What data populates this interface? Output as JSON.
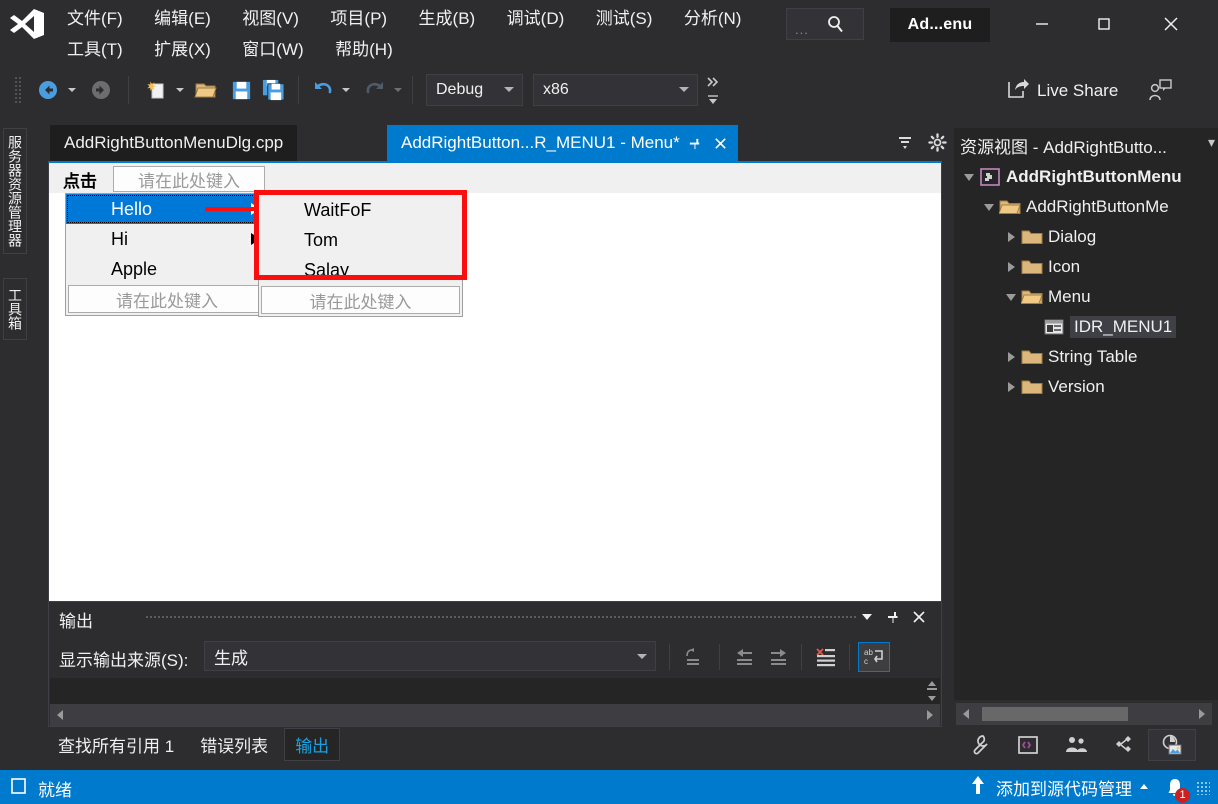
{
  "window": {
    "app_title": "Ad...enu",
    "search_placeholder": "...",
    "minimize_label": "–",
    "maximize_label": "□",
    "close_label": "✕"
  },
  "menubar": {
    "row1": [
      "文件(F)",
      "编辑(E)",
      "视图(V)",
      "项目(P)",
      "生成(B)",
      "调试(D)",
      "测试(S)",
      "分析(N)"
    ],
    "row2": [
      "工具(T)",
      "扩展(X)",
      "窗口(W)",
      "帮助(H)"
    ]
  },
  "toolbar": {
    "configuration": "Debug",
    "platform": "x86",
    "live_share": "Live Share"
  },
  "left_tabs": {
    "server_explorer": "服务器资源管理器",
    "toolbox": "工具箱"
  },
  "document_tabs": {
    "inactive": "AddRightButtonMenuDlg.cpp",
    "active": "AddRightButton...R_MENU1 - Menu*"
  },
  "designer": {
    "menu_strip": {
      "root_item": "点击",
      "type_here": "请在此处键入"
    },
    "dropdown1": {
      "items": [
        {
          "label": "Hello",
          "selected": true,
          "has_submenu": true
        },
        {
          "label": "Hi",
          "selected": false,
          "has_submenu": true
        },
        {
          "label": "Apple",
          "selected": false,
          "has_submenu": false
        }
      ],
      "type_here": "请在此处键入"
    },
    "dropdown2": {
      "items": [
        {
          "label": "WaitFoF"
        },
        {
          "label": "Tom"
        },
        {
          "label": "Salay"
        }
      ],
      "type_here": "请在此处键入"
    },
    "annotation_color": "#fb0e0e",
    "highlight_color": "#0078d7"
  },
  "output": {
    "title": "输出",
    "source_label": "显示输出来源(S):",
    "source_value": "生成"
  },
  "bottom_tabs": [
    {
      "label": "查找所有引用 1",
      "active": false
    },
    {
      "label": "错误列表",
      "active": false
    },
    {
      "label": "输出",
      "active": true
    }
  ],
  "resource_view": {
    "title": "资源视图 - AddRightButto...",
    "tree": [
      {
        "label": "AddRightButtonMenu",
        "depth": 0,
        "twisty": "down",
        "icon": "solution-icon",
        "bold": true,
        "selected": false
      },
      {
        "label": "AddRightButtonMe",
        "depth": 1,
        "twisty": "down",
        "icon": "folder-open-icon",
        "bold": false,
        "selected": false
      },
      {
        "label": "Dialog",
        "depth": 2,
        "twisty": "right",
        "icon": "folder-icon",
        "bold": false,
        "selected": false
      },
      {
        "label": "Icon",
        "depth": 2,
        "twisty": "right",
        "icon": "folder-icon",
        "bold": false,
        "selected": false
      },
      {
        "label": "Menu",
        "depth": 2,
        "twisty": "down",
        "icon": "folder-open-icon",
        "bold": false,
        "selected": false
      },
      {
        "label": "IDR_MENU1",
        "depth": 3,
        "twisty": "none",
        "icon": "menu-resource-icon",
        "bold": false,
        "selected": true
      },
      {
        "label": "String Table",
        "depth": 2,
        "twisty": "right",
        "icon": "folder-icon",
        "bold": false,
        "selected": false
      },
      {
        "label": "Version",
        "depth": 2,
        "twisty": "right",
        "icon": "folder-icon",
        "bold": false,
        "selected": false
      }
    ]
  },
  "statusbar": {
    "status": "就绪",
    "source_control": "添加到源代码管理",
    "notification_count": "1",
    "accent_color": "#007acc"
  }
}
